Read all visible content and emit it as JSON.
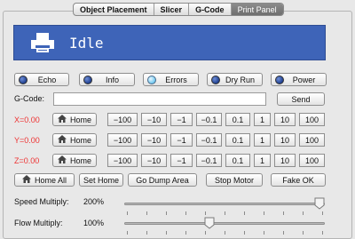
{
  "tabs": [
    {
      "label": "Object Placement"
    },
    {
      "label": "Slicer"
    },
    {
      "label": "G-Code"
    },
    {
      "label": "Print Panel"
    }
  ],
  "status": {
    "text": "Idle"
  },
  "toggles": {
    "echo": "Echo",
    "info": "Info",
    "errors": "Errors",
    "dry_run": "Dry Run",
    "power": "Power"
  },
  "gcode": {
    "label": "G-Code:",
    "value": "",
    "send": "Send"
  },
  "axes": [
    {
      "label": "X=0.00",
      "home": "Home"
    },
    {
      "label": "Y=0.00",
      "home": "Home"
    },
    {
      "label": "Z=0.00",
      "home": "Home"
    }
  ],
  "steps": [
    "−100",
    "−10",
    "−1",
    "−0.1",
    "0.1",
    "1",
    "10",
    "100"
  ],
  "actions": {
    "home_all": "Home All",
    "set_home": "Set Home",
    "go_dump": "Go Dump Area",
    "stop_motor": "Stop Motor",
    "fake_ok": "Fake OK"
  },
  "speed": {
    "label": "Speed Multiply:",
    "value": "200%",
    "level": 1.0
  },
  "flow": {
    "label": "Flow Multiply:",
    "value": "100%",
    "level": 0.42
  },
  "colors": {
    "banner": "#3e64b8",
    "axis_label": "#ee3333"
  }
}
